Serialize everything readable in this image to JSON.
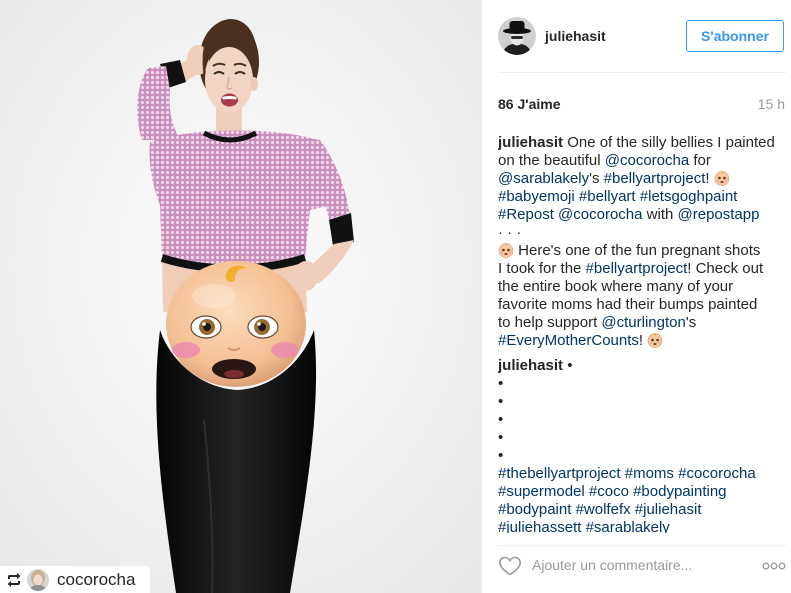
{
  "header": {
    "username": "juliehasit",
    "follow_label": "S'abonner"
  },
  "stats": {
    "likes_count": "86",
    "likes_label": "J'aime",
    "time_ago": "15 h"
  },
  "caption": {
    "lines": [
      [
        {
          "user": "juliehasit"
        },
        {
          "txt": " One of the silly bellies I painted"
        }
      ],
      [
        {
          "txt": "on the beautiful "
        },
        {
          "mention": "@cocorocha"
        },
        {
          "txt": " for"
        }
      ],
      [
        {
          "mention": "@sarablakely"
        },
        {
          "txt": "'s "
        },
        {
          "tag": "#bellyartproject"
        },
        {
          "txt": "! "
        },
        {
          "icon": "baby-emoji"
        }
      ],
      [
        {
          "tag": "#babyemoji"
        },
        {
          "txt": " "
        },
        {
          "tag": "#bellyart"
        },
        {
          "txt": " "
        },
        {
          "tag": "#letsgoghpaint"
        }
      ],
      [
        {
          "tag": "#Repost"
        },
        {
          "txt": " "
        },
        {
          "mention": "@cocorocha"
        },
        {
          "txt": " with "
        },
        {
          "mention": "@repostapp"
        }
      ],
      [
        {
          "txt": "· · ·"
        }
      ],
      [
        {
          "icon": "baby-emoji"
        },
        {
          "txt": " Here's one of the fun pregnant shots"
        }
      ],
      [
        {
          "txt": "I took for the "
        },
        {
          "tag": "#bellyartproject"
        },
        {
          "txt": "! Check out"
        }
      ],
      [
        {
          "txt": "the entire book where many of your"
        }
      ],
      [
        {
          "txt": "favorite moms had their bumps painted"
        }
      ],
      [
        {
          "txt": "to help support "
        },
        {
          "mention": "@cturlington"
        },
        {
          "txt": "'s"
        }
      ],
      [
        {
          "tag": "#EveryMotherCounts"
        },
        {
          "txt": "! "
        },
        {
          "icon": "baby-emoji"
        }
      ]
    ]
  },
  "comment": {
    "lines": [
      [
        {
          "user": "juliehasit"
        },
        {
          "txt": " •"
        }
      ],
      [
        {
          "txt": "•"
        }
      ],
      [
        {
          "txt": "•"
        }
      ],
      [
        {
          "txt": "•"
        }
      ],
      [
        {
          "txt": "•"
        }
      ],
      [
        {
          "txt": "•"
        }
      ],
      [
        {
          "tag": "#thebellyartproject"
        },
        {
          "txt": " "
        },
        {
          "tag": "#moms"
        },
        {
          "txt": " "
        },
        {
          "tag": "#cocorocha"
        }
      ],
      [
        {
          "tag": "#supermodel"
        },
        {
          "txt": " "
        },
        {
          "tag": "#coco"
        },
        {
          "txt": " "
        },
        {
          "tag": "#bodypainting"
        }
      ],
      [
        {
          "tag": "#bodypaint"
        },
        {
          "txt": " "
        },
        {
          "tag": "#wolfefx"
        },
        {
          "txt": " "
        },
        {
          "tag": "#juliehasit"
        }
      ],
      [
        {
          "tag": "#juliehassett"
        },
        {
          "txt": " "
        },
        {
          "tag": "#sarablakely"
        }
      ]
    ]
  },
  "footer": {
    "comment_placeholder": "Ajouter un commentaire..."
  },
  "repost_badge": {
    "username": "cocorocha"
  },
  "icons": {
    "avatar": "user-avatar",
    "like": "heart-outline-icon",
    "more": "more-options-icon",
    "repost": "repost-icon",
    "emoji": "baby-emoji-icon"
  },
  "colors": {
    "link": "#003569",
    "text": "#262626",
    "muted": "#999999",
    "follow": "#3897f0"
  }
}
